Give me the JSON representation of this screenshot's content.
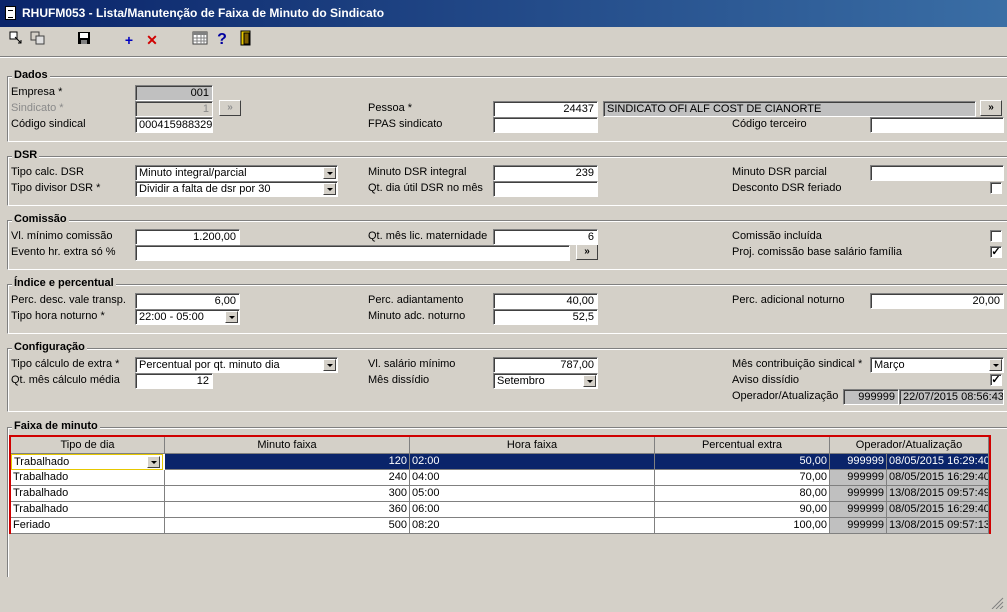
{
  "window": {
    "title": "RHUFM053 - Lista/Manutenção de Faixa de Minuto do Sindicato"
  },
  "toolbar": {
    "icons": [
      "nav-icon",
      "copy-icon",
      "save-icon",
      "add-icon",
      "delete-icon",
      "calendar-icon",
      "help-icon",
      "exit-icon"
    ],
    "add_glyph": "+",
    "delete_glyph": "✕",
    "help_glyph": "?"
  },
  "dados": {
    "title": "Dados",
    "empresa_label": "Empresa *",
    "empresa_value": "001",
    "sindicato_label": "Sindicato *",
    "sindicato_value": "1",
    "sindicato_btn": "»",
    "codigo_sindical_label": "Código sindical",
    "codigo_sindical_value": "000415988329",
    "pessoa_label": "Pessoa *",
    "pessoa_value": "24437",
    "pessoa_name": "SINDICATO OFI ALF COST DE CIANORTE",
    "pessoa_btn": "»",
    "fpas_label": "FPAS sindicato",
    "fpas_value": "",
    "codigo_terceiro_label": "Código terceiro",
    "codigo_terceiro_value": ""
  },
  "dsr": {
    "title": "DSR",
    "tipo_calc_label": "Tipo calc. DSR",
    "tipo_calc_value": "Minuto integral/parcial",
    "tipo_divisor_label": "Tipo divisor DSR *",
    "tipo_divisor_value": "Dividir a falta de dsr por 30",
    "minuto_integral_label": "Minuto DSR integral",
    "minuto_integral_value": "239",
    "qt_dia_util_label": "Qt. dia útil DSR no mês",
    "qt_dia_util_value": "",
    "minuto_parcial_label": "Minuto DSR parcial",
    "minuto_parcial_value": "",
    "desconto_feriado_label": "Desconto DSR feriado",
    "desconto_feriado_checked": ""
  },
  "comissao": {
    "title": "Comissão",
    "vl_minimo_label": "Vl. mínimo comissão",
    "vl_minimo_value": "1.200,00",
    "evento_label": "Evento hr. extra só %",
    "evento_value": "",
    "evento_btn": "»",
    "qt_mes_label": "Qt. mês lic. maternidade",
    "qt_mes_value": "6",
    "incluida_label": "Comissão incluída",
    "incluida_checked": "",
    "proj_label": "Proj. comissão base salário família",
    "proj_checked": "✓"
  },
  "indice": {
    "title": "Índice e percentual",
    "perc_vale_label": "Perc. desc. vale transp.",
    "perc_vale_value": "6,00",
    "tipo_hora_label": "Tipo hora noturno *",
    "tipo_hora_value": "22:00 - 05:00",
    "perc_adiant_label": "Perc. adiantamento",
    "perc_adiant_value": "40,00",
    "minuto_adc_label": "Minuto adc. noturno",
    "minuto_adc_value": "52,5",
    "perc_adic_label": "Perc. adicional noturno",
    "perc_adic_value": "20,00"
  },
  "config": {
    "title": "Configuração",
    "tipo_calc_extra_label": "Tipo cálculo de extra *",
    "tipo_calc_extra_value": "Percentual por qt. minuto dia",
    "qt_mes_media_label": "Qt. mês cálculo média",
    "qt_mes_media_value": "12",
    "vl_salario_label": "Vl. salário mínimo",
    "vl_salario_value": "787,00",
    "mes_dissidio_label": "Mês dissídio",
    "mes_dissidio_value": "Setembro",
    "mes_contrib_label": "Mês contribuição sindical *",
    "mes_contrib_value": "Março",
    "aviso_label": "Aviso dissídio",
    "aviso_checked": "✓",
    "operador_label": "Operador/Atualização",
    "operador_value": "999999",
    "atualizacao_value": "22/07/2015 08:56:43"
  },
  "faixa": {
    "title": "Faixa de minuto",
    "columns": [
      "Tipo de dia",
      "Minuto faixa",
      "Hora faixa",
      "Percentual extra",
      "Operador/Atualização"
    ],
    "rows": [
      {
        "tipo": "Trabalhado",
        "minuto": "120",
        "hora": "02:00",
        "percentual": "50,00",
        "operador": "999999",
        "data": "08/05/2015 16:29:40"
      },
      {
        "tipo": "Trabalhado",
        "minuto": "240",
        "hora": "04:00",
        "percentual": "70,00",
        "operador": "999999",
        "data": "08/05/2015 16:29:40"
      },
      {
        "tipo": "Trabalhado",
        "minuto": "300",
        "hora": "05:00",
        "percentual": "80,00",
        "operador": "999999",
        "data": "13/08/2015 09:57:49"
      },
      {
        "tipo": "Trabalhado",
        "minuto": "360",
        "hora": "06:00",
        "percentual": "90,00",
        "operador": "999999",
        "data": "08/05/2015 16:29:40"
      },
      {
        "tipo": "Feriado",
        "minuto": "500",
        "hora": "08:20",
        "percentual": "100,00",
        "operador": "999999",
        "data": "13/08/2015 09:57:13"
      }
    ]
  }
}
